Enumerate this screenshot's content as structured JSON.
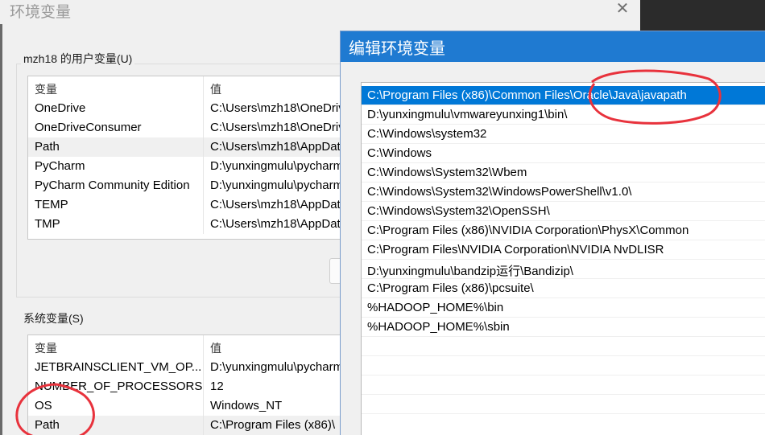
{
  "bg_dialog": {
    "title": "环境变量",
    "close_glyph": "✕",
    "user_group_label": "mzh18 的用户变量(U)",
    "system_group_label": "系统变量(S)",
    "headers": {
      "name": "变量",
      "value": "值"
    },
    "user_vars": [
      {
        "name": "OneDrive",
        "value": "C:\\Users\\mzh18\\OneDrive"
      },
      {
        "name": "OneDriveConsumer",
        "value": "C:\\Users\\mzh18\\OneDrive"
      },
      {
        "name": "Path",
        "value": "C:\\Users\\mzh18\\AppData"
      },
      {
        "name": "PyCharm",
        "value": "D:\\yunxingmulu\\pycharm"
      },
      {
        "name": "PyCharm Community Edition",
        "value": "D:\\yunxingmulu\\pycharm"
      },
      {
        "name": "TEMP",
        "value": "C:\\Users\\mzh18\\AppData"
      },
      {
        "name": "TMP",
        "value": "C:\\Users\\mzh18\\AppData"
      }
    ],
    "system_vars": [
      {
        "name": "JETBRAINSCLIENT_VM_OP...",
        "value": "D:\\yunxingmulu\\pycharm"
      },
      {
        "name": "NUMBER_OF_PROCESSORS",
        "value": "12"
      },
      {
        "name": "OS",
        "value": "Windows_NT"
      },
      {
        "name": "Path",
        "value": "C:\\Program Files (x86)\\"
      }
    ]
  },
  "edit_dialog": {
    "title": "编辑环境变量",
    "paths": [
      "C:\\Program Files (x86)\\Common Files\\Oracle\\Java\\javapath",
      "D:\\yunxingmulu\\vmwareyunxing1\\bin\\",
      "C:\\Windows\\system32",
      "C:\\Windows",
      "C:\\Windows\\System32\\Wbem",
      "C:\\Windows\\System32\\WindowsPowerShell\\v1.0\\",
      "C:\\Windows\\System32\\OpenSSH\\",
      "C:\\Program Files (x86)\\NVIDIA Corporation\\PhysX\\Common",
      "C:\\Program Files\\NVIDIA Corporation\\NVIDIA NvDLISR",
      "D:\\yunxingmulu\\bandzip运行\\Bandizip\\",
      "C:\\Program Files (x86)\\pcsuite\\",
      "%HADOOP_HOME%\\bin",
      "%HADOOP_HOME%\\sbin"
    ],
    "selected_index": 0
  },
  "colors": {
    "title_blue": "#1f7ad1",
    "selection": "#0078d7",
    "annotation": "#e8323c"
  }
}
